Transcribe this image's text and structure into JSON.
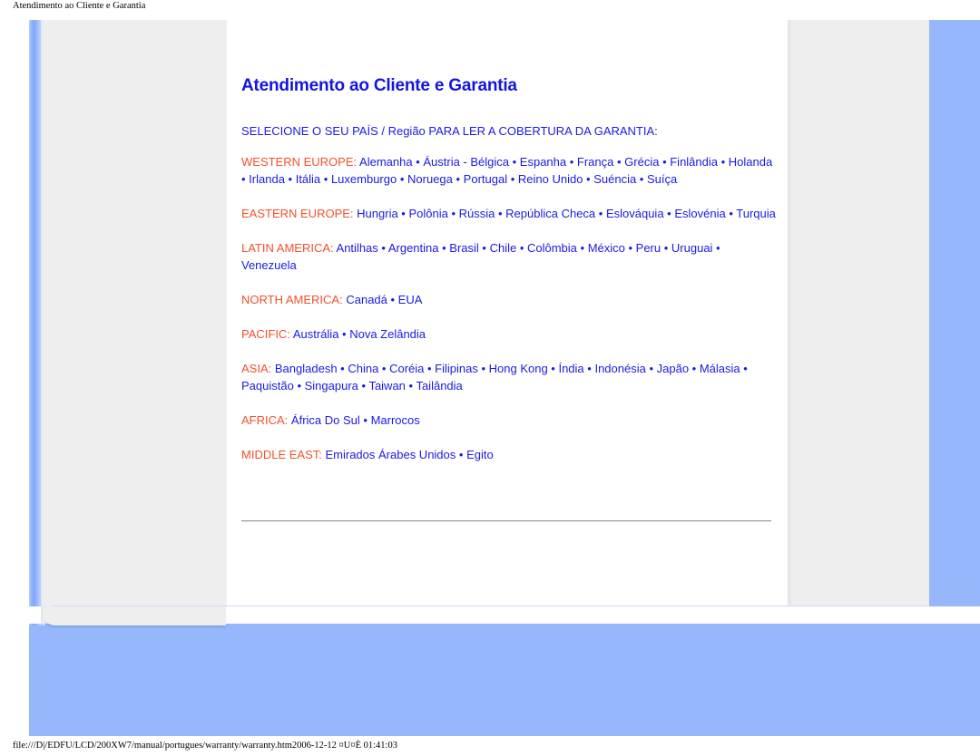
{
  "browser": {
    "print_header": "Atendimento ao Cliente e Garantia",
    "print_footer": "file:///D|/EDFU/LCD/200XW7/manual/portugues/warranty/warranty.htm2006-12-12 ¤U¤È 01:41:03"
  },
  "colors": {
    "title_blue": "#1414e0",
    "link_blue": "#1a1ae4",
    "region_orange": "#f4502b",
    "page_blue": "#96b7fb",
    "sidebar_gray": "#eeeeee"
  },
  "content": {
    "title": "Atendimento ao Cliente e Garantia",
    "lead": "SELECIONE O SEU PAÍS / Região PARA LER A COBERTURA DA GARANTIA:",
    "separator": "•",
    "regions": [
      {
        "label": "WESTERN EUROPE:",
        "countries": [
          "Alemanha",
          "Áustria - Bélgica",
          "Espanha",
          "França",
          "Grécia",
          "Finlândia",
          "Holanda",
          "Irlanda",
          "Itália",
          "Luxemburgo",
          "Noruega",
          "Portugal",
          "Reino Unido",
          "Suéncia",
          "Suíça"
        ]
      },
      {
        "label": "EASTERN EUROPE:",
        "countries": [
          "Hungria",
          "Polônia",
          "Rússia",
          "República Checa",
          "Eslováquia",
          "Eslovénia",
          "Turquia"
        ]
      },
      {
        "label": "LATIN AMERICA:",
        "countries": [
          "Antilhas",
          "Argentina",
          "Brasil",
          "Chile",
          "Colômbia",
          "México",
          "Peru",
          "Uruguai",
          "Venezuela"
        ]
      },
      {
        "label": "NORTH AMERICA:",
        "countries": [
          "Canadá",
          "EUA"
        ]
      },
      {
        "label": "PACIFIC:",
        "countries": [
          "Austrália",
          "Nova Zelândia"
        ]
      },
      {
        "label": "ASIA:",
        "countries": [
          "Bangladesh",
          "China",
          "Coréia",
          "Filipinas",
          "Hong Kong",
          "Índia",
          "Indonésia",
          "Japão",
          "Málasia",
          "Paquistão",
          "Singapura",
          "Taiwan",
          "Tailândia"
        ]
      },
      {
        "label": "AFRICA:",
        "countries": [
          "África Do Sul",
          "Marrocos"
        ]
      },
      {
        "label": "MIDDLE EAST:",
        "countries": [
          "Emirados Árabes Unidos",
          "Egito"
        ]
      }
    ]
  }
}
